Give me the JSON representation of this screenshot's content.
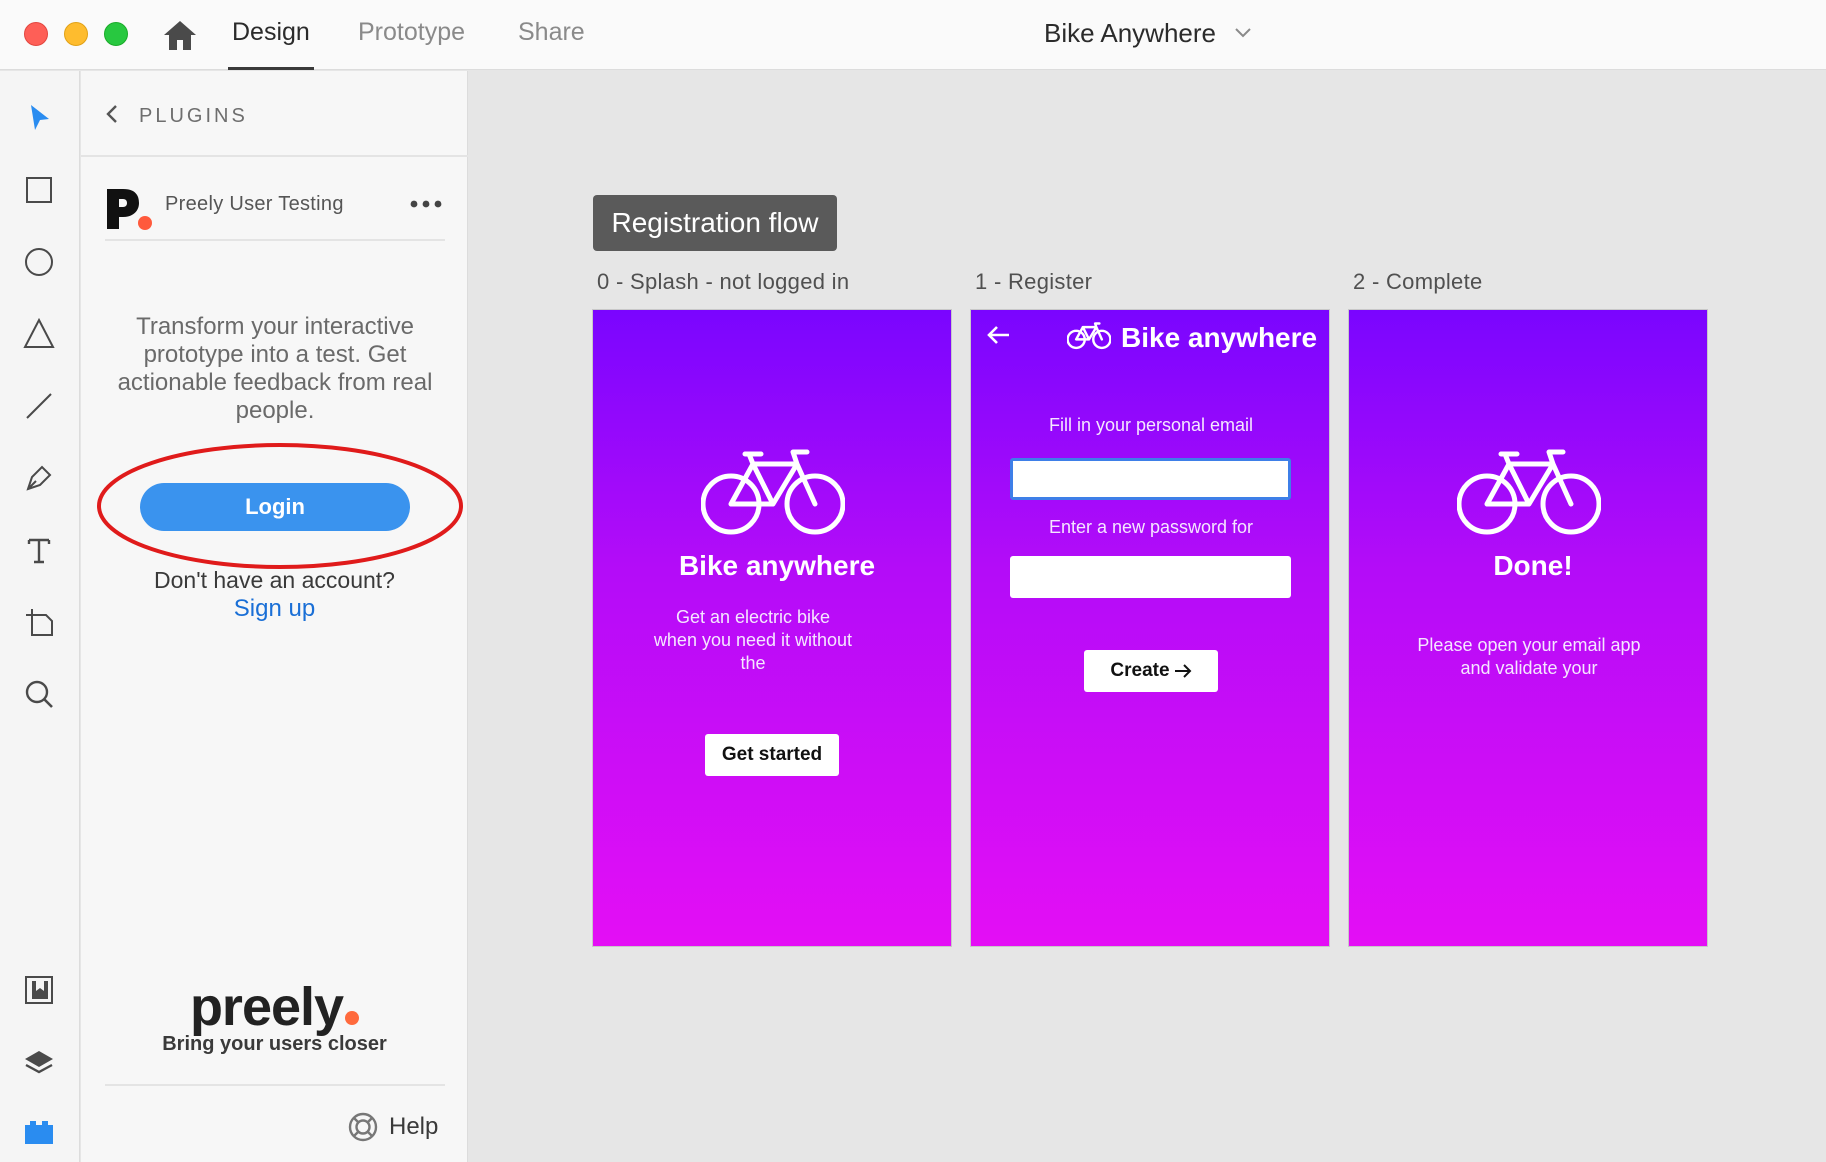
{
  "titlebar": {
    "tabs": [
      {
        "label": "Design"
      },
      {
        "label": "Prototype"
      },
      {
        "label": "Share"
      }
    ],
    "document_title": "Bike Anywhere"
  },
  "toolbar": {
    "tools": [
      "select-icon",
      "rectangle-icon",
      "ellipse-icon",
      "polygon-icon",
      "line-icon",
      "pen-icon",
      "text-icon",
      "artboard-icon",
      "zoom-icon"
    ],
    "bottom_tools": [
      "assets-icon",
      "layers-icon",
      "plugins-icon"
    ],
    "accent_color": "#2a8cf0"
  },
  "plugin_panel": {
    "header_label": "PLUGINS",
    "plugin_name": "Preely User Testing",
    "promo_text": "Transform your interactive prototype into a test. Get actionable feedback from real people.",
    "login_label": "Login",
    "no_account_text": "Don't have an account?",
    "signup_label": "Sign up",
    "brand_name": "preely",
    "brand_tagline": "Bring your users closer",
    "help_label": "Help",
    "login_color": "#3a93ee",
    "highlight_color": "#e01b1b"
  },
  "canvas": {
    "flow_tag": "Registration flow",
    "artboards": [
      {
        "label": "0 - Splash - not logged in",
        "title": "Bike anywhere",
        "body": "Get an electric bike when you need it without the",
        "button_label": "Get started"
      },
      {
        "label": "1 - Register",
        "header_title": "Bike anywhere",
        "email_label": "Fill in your personal email",
        "password_label": "Enter a new password for",
        "button_label": "Create"
      },
      {
        "label": "2 - Complete",
        "title": "Done!",
        "body": "Please open your email app and validate your"
      }
    ],
    "gradient_top": "#7a05ff",
    "gradient_bottom": "#e40ef5"
  }
}
